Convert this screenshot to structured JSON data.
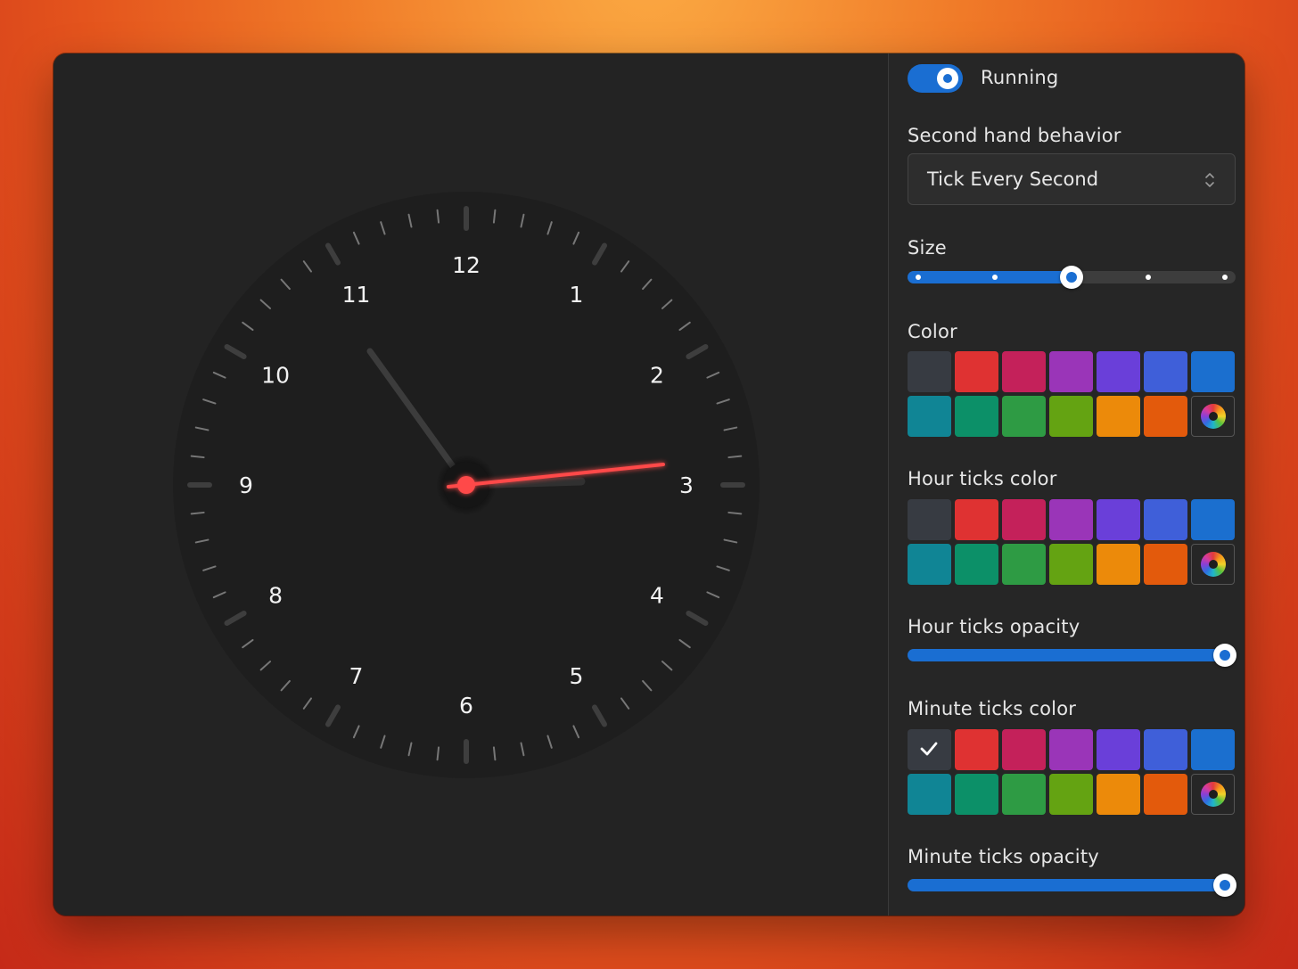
{
  "clock": {
    "numerals": [
      "12",
      "1",
      "2",
      "3",
      "4",
      "5",
      "6",
      "7",
      "8",
      "9",
      "10",
      "11"
    ],
    "hand_color": "#ff4a4a",
    "minute_hand_color": "#3a3a3a"
  },
  "sidebar": {
    "running": {
      "label": "Running",
      "on": true
    },
    "second_hand_behavior": {
      "label": "Second hand behavior",
      "value": "Tick Every Second"
    },
    "size": {
      "label": "Size",
      "value_fraction": 0.5,
      "stops": 5
    },
    "color": {
      "label": "Color",
      "selected": null
    },
    "hour_ticks_color": {
      "label": "Hour ticks color",
      "selected": null
    },
    "hour_ticks_opacity": {
      "label": "Hour ticks opacity",
      "value_fraction": 1.0
    },
    "minute_ticks_color": {
      "label": "Minute ticks color",
      "selected": 0
    },
    "minute_ticks_opacity": {
      "label": "Minute ticks opacity",
      "value_fraction": 1.0
    }
  },
  "palette": [
    {
      "name": "graphite",
      "hex": "#373b42"
    },
    {
      "name": "red",
      "hex": "#df3232"
    },
    {
      "name": "crimson",
      "hex": "#c4215a"
    },
    {
      "name": "purple",
      "hex": "#9a35b8"
    },
    {
      "name": "violet",
      "hex": "#6a3fd9"
    },
    {
      "name": "indigo",
      "hex": "#3f5fd9"
    },
    {
      "name": "blue",
      "hex": "#1b6fcf"
    },
    {
      "name": "teal",
      "hex": "#108595"
    },
    {
      "name": "green",
      "hex": "#0c9068"
    },
    {
      "name": "emerald",
      "hex": "#2e9b44"
    },
    {
      "name": "lime",
      "hex": "#64a312"
    },
    {
      "name": "amber",
      "hex": "#ec8a0a"
    },
    {
      "name": "orange",
      "hex": "#e35a0c"
    },
    {
      "name": "custom-color-picker",
      "hex": "#262626"
    }
  ]
}
